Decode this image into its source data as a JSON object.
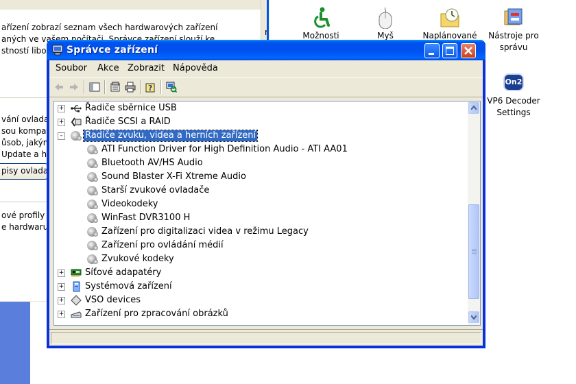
{
  "background_window": {
    "lines_top": [
      "ařízení zobrazí seznam všech hardwarových zařízení",
      "aných ve vašem počítači. Správce zařízení slouží ke",
      "stností libov"
    ],
    "lines_middle": [
      "vání ovladač",
      "sou kompat",
      "ůsob, jakým",
      "Update a hle"
    ],
    "button_label": "pisy ovladač",
    "lines_bottom": [
      "ové profily po",
      "e hardwaru."
    ],
    "partial_char": "r"
  },
  "desktop_icons": [
    {
      "name": "accessibility",
      "label": "Možnosti",
      "icon": "accessibility-icon"
    },
    {
      "name": "mouse",
      "label": "Myš",
      "icon": "mouse-icon"
    },
    {
      "name": "scheduled",
      "label": "Naplánované",
      "icon": "folder-clock-icon"
    },
    {
      "name": "admin-tools",
      "label": "Nástroje pro správu",
      "icon": "admin-tools-icon"
    },
    {
      "name": "vp6",
      "label": "VP6 Decoder Settings",
      "icon": "vp6-icon",
      "badge": "On2"
    }
  ],
  "window": {
    "title": "Správce zařízení",
    "menu": [
      "Soubor",
      "Akce",
      "Zobrazit",
      "Nápověda"
    ]
  },
  "tree": {
    "rows": [
      {
        "label": "Řadiče sběrnice USB",
        "icon": "usb-icon",
        "level": 0,
        "expander": "+"
      },
      {
        "label": "Řadiče SCSI a RAID",
        "icon": "scsi-icon",
        "level": 0,
        "expander": "+"
      },
      {
        "label": "Řadiče zvuku, videa a herních zařízení",
        "icon": "sound-icon",
        "level": 0,
        "expander": "-",
        "selected": true
      },
      {
        "label": "ATI Function Driver for High Definition Audio - ATI AA01",
        "icon": "sound-icon",
        "level": 1
      },
      {
        "label": "Bluetooth AV/HS Audio",
        "icon": "sound-icon",
        "level": 1
      },
      {
        "label": "Sound Blaster X-Fi Xtreme Audio",
        "icon": "sound-icon",
        "level": 1
      },
      {
        "label": "Starší zvukové ovladače",
        "icon": "sound-icon",
        "level": 1
      },
      {
        "label": "Videokodeky",
        "icon": "sound-icon",
        "level": 1
      },
      {
        "label": "WinFast DVR3100 H",
        "icon": "sound-icon",
        "level": 1
      },
      {
        "label": "Zařízení pro digitalizaci videa v režimu Legacy",
        "icon": "sound-icon",
        "level": 1
      },
      {
        "label": "Zařízení pro ovládání médií",
        "icon": "sound-icon",
        "level": 1
      },
      {
        "label": "Zvukové kodeky",
        "icon": "sound-icon",
        "level": 1
      },
      {
        "label": "Síťové adapatéry",
        "icon": "network-card-icon",
        "level": 0,
        "expander": "+"
      },
      {
        "label": "Systémová zařízení",
        "icon": "system-device-icon",
        "level": 0,
        "expander": "+"
      },
      {
        "label": "VSO devices",
        "icon": "vso-icon",
        "level": 0,
        "expander": "+"
      },
      {
        "label": "Zařízení pro zpracování obrázků",
        "icon": "scanner-icon",
        "level": 0,
        "expander": "+"
      }
    ]
  },
  "colors": {
    "selection": "#316ac5",
    "titlebar": "#0053ee",
    "face": "#ece9d8"
  }
}
